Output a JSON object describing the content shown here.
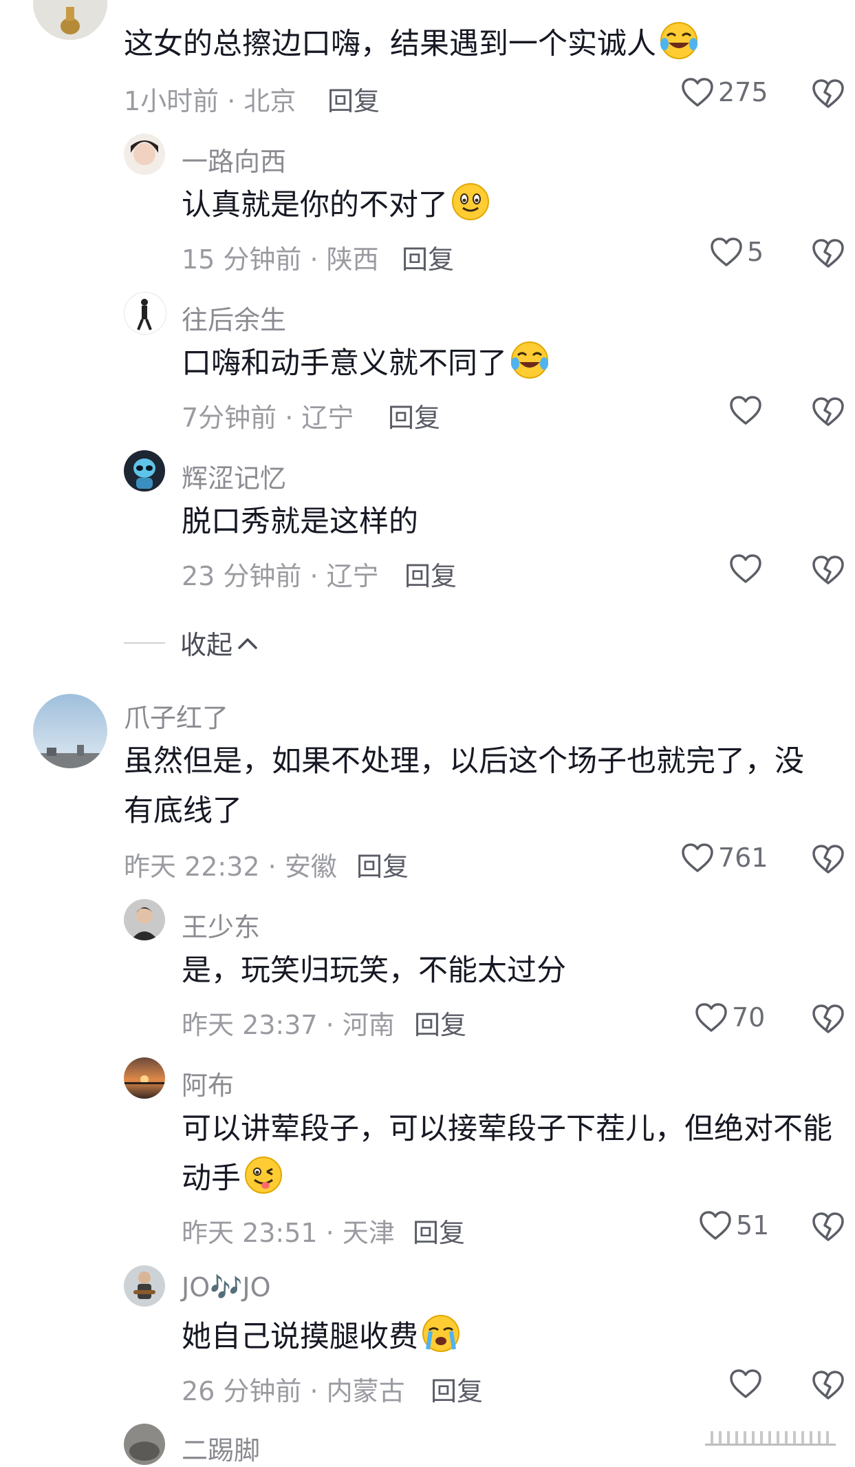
{
  "comments": [
    {
      "name": "",
      "text": "这女的总擦边口嗨，结果遇到一个实诚人",
      "emoji": "laughing-crying-emoji",
      "time": "1小时前 · 北京",
      "reply": "回复",
      "likes": "275"
    },
    {
      "name": "一路向西",
      "text": "认真就是你的不对了",
      "emoji": "smiling-emoji",
      "time": "15 分钟前 · 陕西",
      "reply": "回复",
      "likes": "5"
    },
    {
      "name": "往后余生",
      "text": "口嗨和动手意义就不同了",
      "emoji": "laughing-crying-emoji",
      "time": "7分钟前 · 辽宁",
      "reply": "回复",
      "likes": ""
    },
    {
      "name": "辉涩记忆",
      "text": "脱口秀就是这样的",
      "time": "23 分钟前 · 辽宁",
      "reply": "回复",
      "likes": ""
    },
    {
      "name": "爪子红了",
      "text_line1": "虽然但是，如果不处理，以后这个场子也就完了，没",
      "text_line2": "有底线了",
      "time": "昨天 22:32 · 安徽",
      "reply": "回复",
      "likes": "761"
    },
    {
      "name": "王少东",
      "text": "是，玩笑归玩笑，不能太过分",
      "time": "昨天 23:37 · 河南",
      "reply": "回复",
      "likes": "70"
    },
    {
      "name": "阿布",
      "text_line1": "可以讲荤段子，可以接荤段子下茬儿，但绝对不能",
      "text_line2": "动手",
      "emoji": "winking-tongue-emoji",
      "time": "昨天 23:51 · 天津",
      "reply": "回复",
      "likes": "51"
    },
    {
      "name": "JO🎶JO",
      "text": "她自己说摸腿收费",
      "emoji": "crying-emoji",
      "time": "26 分钟前 · 内蒙古",
      "reply": "回复",
      "likes": ""
    },
    {
      "name": "二踢脚"
    }
  ],
  "collapse_label": "收起",
  "colors": {
    "meta_gray": "#9a9ba1",
    "name_gray": "#8a8b91",
    "text_dark": "#161823"
  }
}
